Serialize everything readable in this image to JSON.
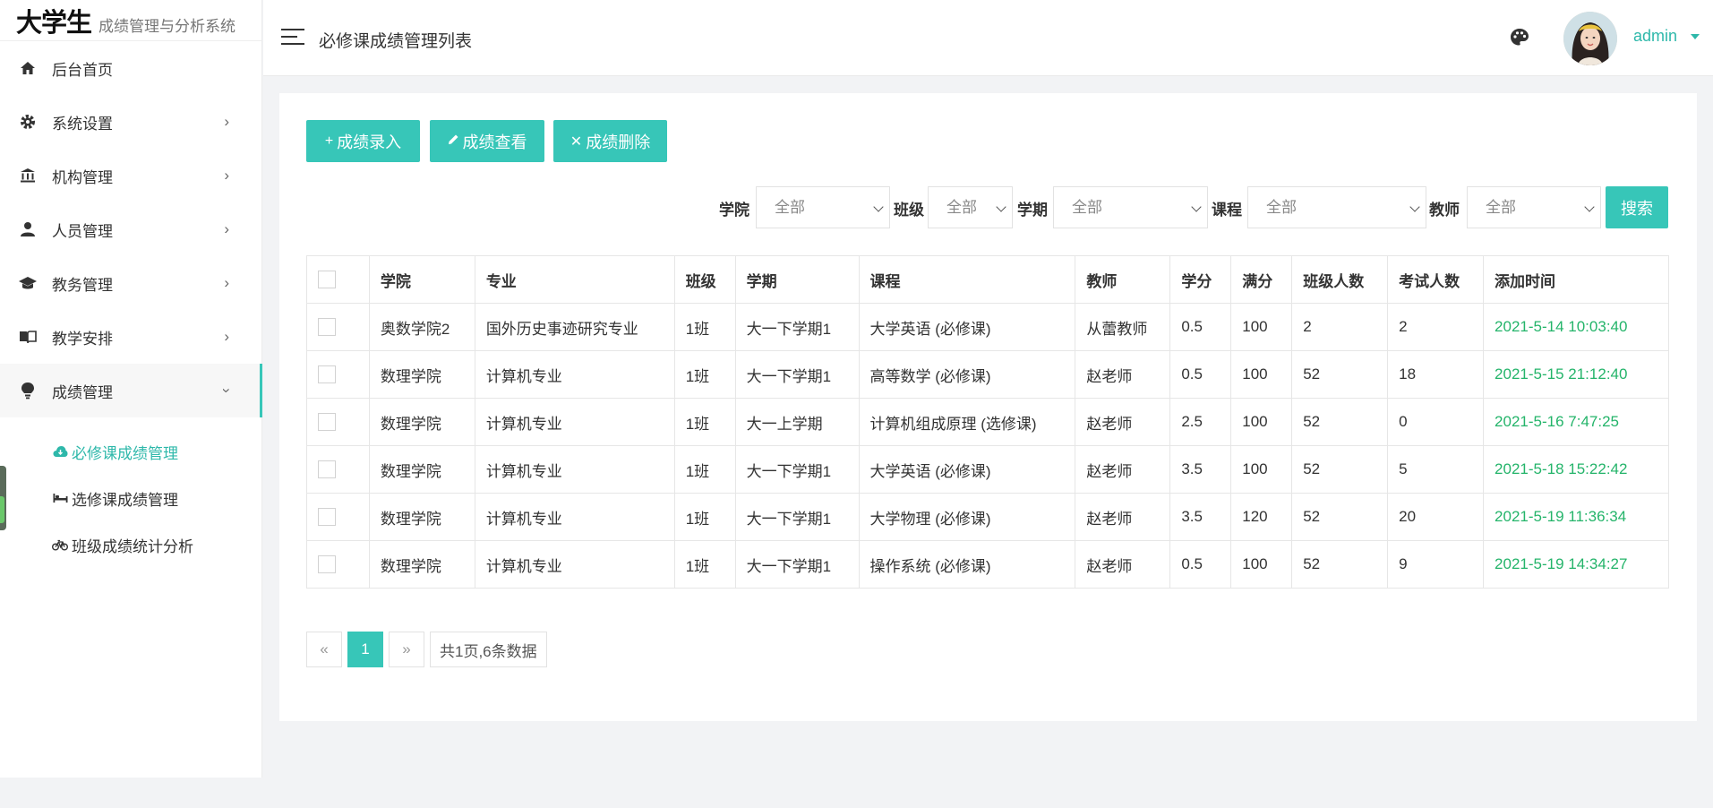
{
  "logo": {
    "big": "大学生",
    "sub": "成绩管理与分析系统"
  },
  "sidebar": {
    "items": [
      {
        "label": "后台首页",
        "icon": "home-icon",
        "has_arrow": false
      },
      {
        "label": "系统设置",
        "icon": "gear-icon",
        "has_arrow": true
      },
      {
        "label": "机构管理",
        "icon": "bank-icon",
        "has_arrow": true
      },
      {
        "label": "人员管理",
        "icon": "user-icon",
        "has_arrow": true
      },
      {
        "label": "教务管理",
        "icon": "graduation-cap-icon",
        "has_arrow": true
      },
      {
        "label": "教学安排",
        "icon": "book-icon",
        "has_arrow": true
      },
      {
        "label": "成绩管理",
        "icon": "lightbulb-icon",
        "has_arrow": true,
        "expanded": true
      }
    ],
    "sub_items": [
      {
        "label": "必修课成绩管理",
        "icon": "cloud-icon",
        "active": true
      },
      {
        "label": "选修课成绩管理",
        "icon": "bed-icon",
        "active": false
      },
      {
        "label": "班级成绩统计分析",
        "icon": "bicycle-icon",
        "active": false
      }
    ]
  },
  "header": {
    "title": "必修课成绩管理列表",
    "user": "admin"
  },
  "toolbar": {
    "add_label": "成绩录入",
    "view_label": "成绩查看",
    "delete_label": "成绩删除"
  },
  "filters": {
    "college_label": "学院",
    "college_value": "全部",
    "class_label": "班级",
    "class_value": "全部",
    "term_label": "学期",
    "term_value": "全部",
    "course_label": "课程",
    "course_value": "全部",
    "teacher_label": "教师",
    "teacher_value": "全部",
    "search_label": "搜索"
  },
  "table": {
    "headers": [
      "学院",
      "专业",
      "班级",
      "学期",
      "课程",
      "教师",
      "学分",
      "满分",
      "班级人数",
      "考试人数",
      "添加时间"
    ],
    "rows": [
      [
        "奥数学院2",
        "国外历史事迹研究专业",
        "1班",
        "大一下学期1",
        "大学英语 (必修课)",
        "从蕾教师",
        "0.5",
        "100",
        "2",
        "2",
        "2021-5-14 10:03:40"
      ],
      [
        "数理学院",
        "计算机专业",
        "1班",
        "大一下学期1",
        "高等数学 (必修课)",
        "赵老师",
        "0.5",
        "100",
        "52",
        "18",
        "2021-5-15 21:12:40"
      ],
      [
        "数理学院",
        "计算机专业",
        "1班",
        "大一上学期",
        "计算机组成原理 (选修课)",
        "赵老师",
        "2.5",
        "100",
        "52",
        "0",
        "2021-5-16 7:47:25"
      ],
      [
        "数理学院",
        "计算机专业",
        "1班",
        "大一下学期1",
        "大学英语 (必修课)",
        "赵老师",
        "3.5",
        "100",
        "52",
        "5",
        "2021-5-18 15:22:42"
      ],
      [
        "数理学院",
        "计算机专业",
        "1班",
        "大一下学期1",
        "大学物理 (必修课)",
        "赵老师",
        "3.5",
        "120",
        "52",
        "20",
        "2021-5-19 11:36:34"
      ],
      [
        "数理学院",
        "计算机专业",
        "1班",
        "大一下学期1",
        "操作系统 (必修课)",
        "赵老师",
        "0.5",
        "100",
        "52",
        "9",
        "2021-5-19 14:34:27"
      ]
    ]
  },
  "pager": {
    "prev": "«",
    "current": "1",
    "next": "»",
    "info": "共1页,6条数据"
  },
  "colors": {
    "accent": "#37c6b8",
    "time_green": "#24b46a"
  }
}
